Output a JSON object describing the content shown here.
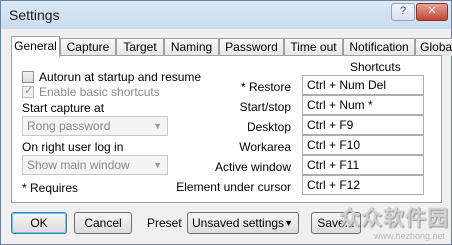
{
  "window": {
    "title": "Settings",
    "help_label": "?",
    "close_label": "✕"
  },
  "tabs": [
    {
      "label": "General",
      "active": true
    },
    {
      "label": "Capture"
    },
    {
      "label": "Target"
    },
    {
      "label": "Naming"
    },
    {
      "label": "Password"
    },
    {
      "label": "Time out"
    },
    {
      "label": "Notification"
    },
    {
      "label": "Global"
    }
  ],
  "general": {
    "autorun_label": "Autorun at startup and resume",
    "basic_shortcuts_label": "Enable basic shortcuts",
    "start_capture_label": "Start capture at",
    "start_capture_value": "Rong password",
    "right_login_label": "On right user log in",
    "right_login_value": "Show main window",
    "requires_note": "* Requires"
  },
  "shortcuts": {
    "title": "Shortcuts",
    "items": [
      {
        "label": "* Restore",
        "value": "Ctrl + Num Del"
      },
      {
        "label": "Start/stop",
        "value": "Ctrl + Num *"
      },
      {
        "label": "Desktop",
        "value": "Ctrl + F9"
      },
      {
        "label": "Workarea",
        "value": "Ctrl + F10"
      },
      {
        "label": "Active window",
        "value": "Ctrl + F11"
      },
      {
        "label": "Element under cursor",
        "value": "Ctrl + F12"
      }
    ]
  },
  "footer": {
    "ok_label": "OK",
    "cancel_label": "Cancel",
    "preset_label": "Preset",
    "preset_value": "Unsaved settings",
    "save_label": "Save..."
  },
  "watermark": {
    "text": "众众软件园",
    "url": "www.hezhong.net"
  }
}
